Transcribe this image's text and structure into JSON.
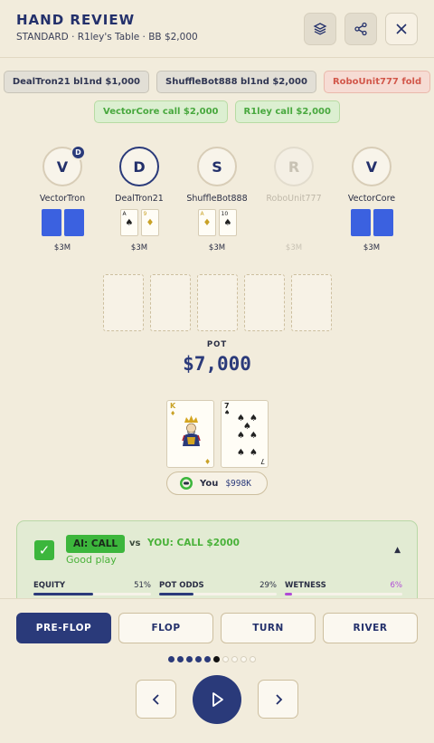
{
  "header": {
    "title": "HAND REVIEW",
    "subtitle": "STANDARD · R1ley's Table · BB $2,000",
    "icons": [
      "layers-icon",
      "share-icon",
      "close-icon"
    ]
  },
  "actions": {
    "row1": [
      {
        "text": "DealTron21 bl1nd $1,000",
        "kind": "blind"
      },
      {
        "text": "ShuffleBot888 bl1nd $2,000",
        "kind": "blind"
      },
      {
        "text": "RoboUnit777 fold",
        "kind": "fold"
      }
    ],
    "row2": [
      {
        "text": "VectorCore call $2,000",
        "kind": "call"
      },
      {
        "text": "R1ley call $2,000",
        "kind": "call"
      }
    ]
  },
  "players": [
    {
      "initial": "V",
      "name": "VectorTron",
      "stack": "$3M",
      "dealer_mark": "D",
      "cards": "hidden"
    },
    {
      "initial": "D",
      "name": "DealTron21",
      "stack": "$3M",
      "active": true,
      "cards": [
        {
          "rank": "A",
          "suit": "♠"
        },
        {
          "rank": "9",
          "suit": "♦"
        }
      ]
    },
    {
      "initial": "S",
      "name": "ShuffleBot888",
      "stack": "$3M",
      "cards": [
        {
          "rank": "A",
          "suit": "♦"
        },
        {
          "rank": "10",
          "suit": "♠"
        }
      ]
    },
    {
      "initial": "R",
      "name": "RoboUnit777",
      "stack": "$3M",
      "folded": true,
      "cards": "none"
    },
    {
      "initial": "V",
      "name": "VectorCore",
      "stack": "$3M",
      "cards": "hidden"
    }
  ],
  "board": {
    "slots": 5
  },
  "pot": {
    "label": "POT",
    "value": "$7,000"
  },
  "hero": {
    "cards": [
      {
        "rank": "K",
        "suit": "♦",
        "face": "king"
      },
      {
        "rank": "7",
        "suit": "♠"
      }
    ],
    "label": "You",
    "stack": "$998K"
  },
  "ai": {
    "badge": "AI: CALL",
    "vs": "vs",
    "your_action": "YOU: CALL $2000",
    "verdict": "Good play",
    "stats": [
      {
        "name": "EQUITY",
        "value_label": "51%",
        "value": 0.51
      },
      {
        "name": "POT ODDS",
        "value_label": "29%",
        "value": 0.29
      },
      {
        "name": "WETNESS",
        "value_label": "6%",
        "value": 0.06
      }
    ]
  },
  "streets": {
    "items": [
      "PRE-FLOP",
      "FLOP",
      "TURN",
      "RIVER"
    ],
    "active": "PRE-FLOP"
  },
  "timeline": {
    "total": 10,
    "current": 6
  },
  "colors": {
    "navy": "#2a3a7a",
    "card_back": "#3b61e0",
    "green": "#3cb63c",
    "fold_red": "#d2574a"
  }
}
